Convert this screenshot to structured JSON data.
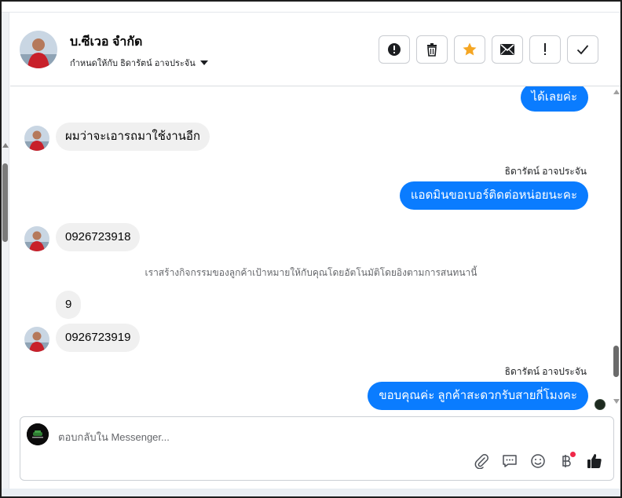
{
  "header": {
    "name": "บ.ซีเวอ จำกัด",
    "assigned_to": "กำหนดให้กับ ธิดารัตน์ อาจประจัน"
  },
  "toolbar": {
    "icons": [
      "alert-circle-icon",
      "trash-icon",
      "star-icon",
      "envelope-icon",
      "exclamation-icon",
      "check-icon"
    ],
    "star_color": "#f5a623"
  },
  "messages": [
    {
      "side": "out",
      "text": "ได้เลยค่ะ"
    },
    {
      "side": "in",
      "text": "ผมว่าจะเอารถมาใช้งานอีก"
    },
    {
      "side": "sender",
      "text": "ธิดารัตน์ อาจประจัน"
    },
    {
      "side": "out",
      "text": "แอดมินขอเบอร์ติดต่อหน่อยนะคะ"
    },
    {
      "side": "in",
      "text": "0926723918"
    },
    {
      "side": "system",
      "text": "เราสร้างกิจกรรมของลูกค้าเป้าหมายให้กับคุณโดยอัตโนมัติโดยอิงตามการสนทนานี้"
    },
    {
      "side": "in",
      "text": "9"
    },
    {
      "side": "in",
      "text": "0926723919"
    },
    {
      "side": "sender",
      "text": "ธิดารัตน์ อาจประจัน"
    },
    {
      "side": "out",
      "text": "ขอบคุณค่ะ ลูกค้าสะดวกรับสายกี่โมงคะ"
    }
  ],
  "composer": {
    "placeholder": "ตอบกลับใน Messenger...",
    "icons": [
      "paperclip-icon",
      "chat-bubble-icon",
      "emoji-icon",
      "baht-icon",
      "thumbs-up-icon"
    ]
  },
  "colors": {
    "outgoing_bubble": "#0a7cff",
    "incoming_bubble": "#f0f0f0",
    "notification_dot": "#f02849"
  }
}
